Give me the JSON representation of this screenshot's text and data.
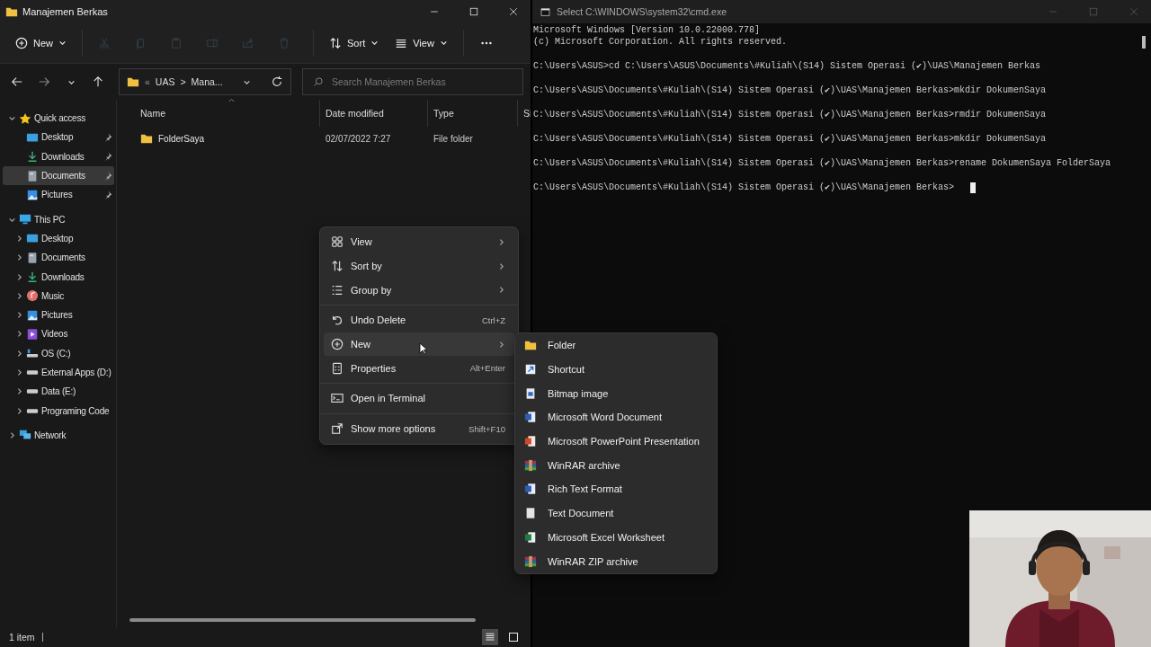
{
  "explorer": {
    "title": "Manajemen Berkas",
    "toolbar": [
      {
        "kind": "new",
        "label": "New",
        "disabled": false
      },
      {
        "kind": "cut",
        "disabled": true
      },
      {
        "kind": "copy",
        "disabled": true
      },
      {
        "kind": "paste",
        "disabled": true
      },
      {
        "kind": "rename",
        "disabled": true
      },
      {
        "kind": "share",
        "disabled": true
      },
      {
        "kind": "delete",
        "disabled": true
      },
      {
        "kind": "sort",
        "label": "Sort",
        "disabled": false
      },
      {
        "kind": "view",
        "label": "View",
        "disabled": false
      },
      {
        "kind": "more",
        "disabled": false
      }
    ],
    "address": {
      "overflow": "«",
      "path": [
        "UAS",
        "Mana..."
      ],
      "separator": ">"
    },
    "search": {
      "placeholder": "Search Manajemen Berkas"
    },
    "sidebar": [
      {
        "label": "Quick access",
        "kind": "star",
        "expanded": true,
        "selected": false,
        "children": [
          {
            "label": "Desktop",
            "kind": "desktop",
            "pinned": true,
            "selected": false
          },
          {
            "label": "Downloads",
            "kind": "downloads",
            "pinned": true,
            "selected": false
          },
          {
            "label": "Documents",
            "kind": "documents",
            "pinned": true,
            "selected": true
          },
          {
            "label": "Pictures",
            "kind": "pictures",
            "pinned": true,
            "selected": false
          }
        ]
      },
      {
        "label": "This PC",
        "kind": "pc",
        "expanded": true,
        "selected": false,
        "children": [
          {
            "label": "Desktop",
            "kind": "desktop",
            "expanded": false,
            "selected": false
          },
          {
            "label": "Documents",
            "kind": "documents",
            "expanded": false,
            "selected": false
          },
          {
            "label": "Downloads",
            "kind": "downloads",
            "expanded": false,
            "selected": false
          },
          {
            "label": "Music",
            "kind": "music",
            "expanded": false,
            "selected": false
          },
          {
            "label": "Pictures",
            "kind": "pictures",
            "expanded": false,
            "selected": false
          },
          {
            "label": "Videos",
            "kind": "videos",
            "expanded": false,
            "selected": false
          },
          {
            "label": "OS (C:)",
            "kind": "osdrive",
            "expanded": false,
            "selected": false
          },
          {
            "label": "External Apps (D:)",
            "kind": "drive",
            "expanded": false,
            "selected": false
          },
          {
            "label": "Data (E:)",
            "kind": "drive",
            "expanded": false,
            "selected": false
          },
          {
            "label": "Programing Code",
            "kind": "drive",
            "expanded": false,
            "selected": false
          }
        ]
      },
      {
        "label": "Network",
        "kind": "network",
        "expanded": false,
        "selected": false
      }
    ],
    "columns": [
      {
        "label": "Name",
        "sorted": true
      },
      {
        "label": "Date modified",
        "sorted": false
      },
      {
        "label": "Type",
        "sorted": false
      },
      {
        "label": "Si",
        "sorted": false
      }
    ],
    "rows": [
      {
        "name": "FolderSaya",
        "date_modified": "02/07/2022 7:27",
        "type": "File folder"
      }
    ],
    "status_bar": {
      "count": "1 item",
      "views": [
        {
          "kind": "details",
          "selected": true
        },
        {
          "kind": "tiles",
          "selected": false
        }
      ]
    }
  },
  "terminal": {
    "title": "Select C:\\WINDOWS\\system32\\cmd.exe",
    "blocks": [
      [
        "Microsoft Windows [Version 10.0.22000.778]",
        "(c) Microsoft Corporation. All rights reserved."
      ],
      [
        "C:\\Users\\ASUS>cd C:\\Users\\ASUS\\Documents\\#Kuliah\\(S14) Sistem Operasi (✔)\\UAS\\Manajemen Berkas"
      ],
      [
        "C:\\Users\\ASUS\\Documents\\#Kuliah\\(S14) Sistem Operasi (✔)\\UAS\\Manajemen Berkas>mkdir DokumenSaya"
      ],
      [
        "C:\\Users\\ASUS\\Documents\\#Kuliah\\(S14) Sistem Operasi (✔)\\UAS\\Manajemen Berkas>rmdir DokumenSaya"
      ],
      [
        "C:\\Users\\ASUS\\Documents\\#Kuliah\\(S14) Sistem Operasi (✔)\\UAS\\Manajemen Berkas>mkdir DokumenSaya"
      ],
      [
        "C:\\Users\\ASUS\\Documents\\#Kuliah\\(S14) Sistem Operasi (✔)\\UAS\\Manajemen Berkas>rename DokumenSaya FolderSaya"
      ],
      [
        "C:\\Users\\ASUS\\Documents\\#Kuliah\\(S14) Sistem Operasi (✔)\\UAS\\Manajemen Berkas>"
      ]
    ],
    "cursor": true
  },
  "context_menu": {
    "groups": [
      [
        {
          "label": "View",
          "kind": "view",
          "submenu": true,
          "selected": false
        },
        {
          "label": "Sort by",
          "kind": "sort",
          "submenu": true,
          "selected": false
        },
        {
          "label": "Group by",
          "kind": "group",
          "submenu": true,
          "selected": false
        }
      ],
      [
        {
          "label": "Undo Delete",
          "kind": "undo",
          "shortcut": "Ctrl+Z",
          "selected": false
        },
        {
          "label": "New",
          "kind": "new",
          "submenu": true,
          "selected": true
        },
        {
          "label": "Properties",
          "kind": "properties",
          "shortcut": "Alt+Enter",
          "selected": false
        }
      ],
      [
        {
          "label": "Open in Terminal",
          "kind": "terminal",
          "selected": false
        }
      ],
      [
        {
          "label": "Show more options",
          "kind": "more",
          "shortcut": "Shift+F10",
          "selected": false
        }
      ]
    ]
  },
  "new_submenu": [
    {
      "label": "Folder",
      "kind": "folder"
    },
    {
      "label": "Shortcut",
      "kind": "shortcut"
    },
    {
      "label": "Bitmap image",
      "kind": "bitmap"
    },
    {
      "label": "Microsoft Word Document",
      "kind": "word"
    },
    {
      "label": "Microsoft PowerPoint Presentation",
      "kind": "powerpoint"
    },
    {
      "label": "WinRAR archive",
      "kind": "rar"
    },
    {
      "label": "Rich Text Format",
      "kind": "rtf"
    },
    {
      "label": "Text Document",
      "kind": "text"
    },
    {
      "label": "Microsoft Excel Worksheet",
      "kind": "excel"
    },
    {
      "label": "WinRAR ZIP archive",
      "kind": "rar"
    }
  ]
}
